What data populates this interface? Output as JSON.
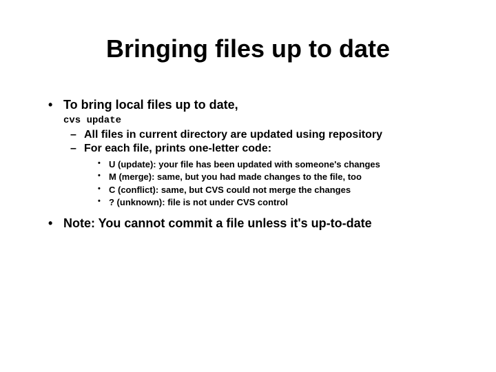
{
  "title": "Bringing files up to date",
  "bullets": {
    "item1": {
      "text": "To bring local files up to date,",
      "code": "cvs update",
      "sub": [
        "All files in current directory are updated using repository",
        "For each file, prints one-letter code:"
      ],
      "codes": [
        "U (update): your file has been updated with someone's changes",
        "M (merge): same, but you had made changes to the file, too",
        "C (conflict): same, but CVS could not merge the changes",
        "? (unknown): file is not under CVS control"
      ]
    },
    "item2": {
      "text": "Note:  You cannot commit a file unless it's up-to-date"
    }
  }
}
